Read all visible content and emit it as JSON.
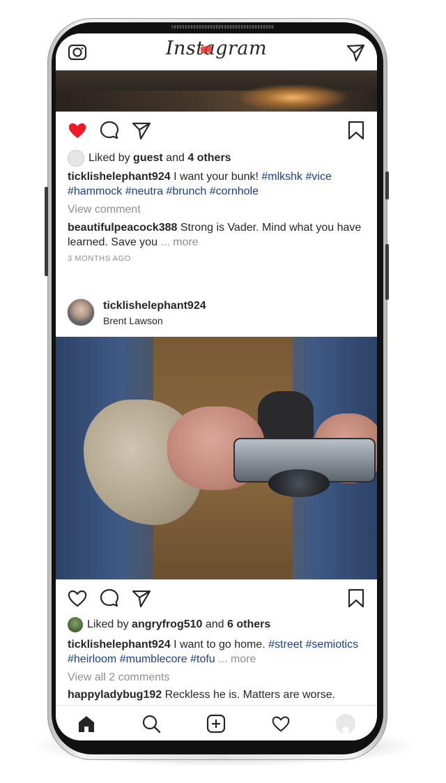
{
  "app": {
    "title": "Instagram"
  },
  "post1": {
    "liked": true,
    "liked_by_prefix": "Liked by",
    "liked_by_user": "guest",
    "liked_by_and": "and",
    "liked_by_others": "4 others",
    "caption_user": "ticklishelephant924",
    "caption_text": " I want your bunk! ",
    "tags": [
      "#mlkshk",
      "#vice",
      "#hammock",
      "#neutra",
      "#brunch",
      "#cornhole"
    ],
    "view_comments": "View comment",
    "comment_user": "beautifulpeacock388",
    "comment_text": " Strong is Vader. Mind what you have learned. Save you",
    "more": "... more",
    "time": "3 MONTHS AGO"
  },
  "post2": {
    "username": "ticklishelephant924",
    "location": "Brent Lawson",
    "liked": false,
    "liked_by_prefix": "Liked by",
    "liked_by_user": "angryfrog510",
    "liked_by_and": "and",
    "liked_by_others": "6 others",
    "caption_user": "ticklishelephant924",
    "caption_text": " I want to go home. ",
    "tags": [
      "#street",
      "#semiotics",
      "#heirloom",
      "#mumblecore",
      "#tofu"
    ],
    "more": "... more",
    "view_comments": "View all 2 comments",
    "comment_user": "happyladybug192",
    "comment_text": " Reckless he is. Matters are worse."
  },
  "icons": {
    "camera": "camera-icon",
    "direct": "paper-plane-icon",
    "heart": "heart-icon",
    "comment": "comment-icon",
    "share": "paper-plane-icon",
    "bookmark": "bookmark-icon",
    "home": "home-icon",
    "search": "search-icon",
    "add": "add-post-icon",
    "activity": "heart-icon",
    "profile": "profile-avatar"
  },
  "colors": {
    "like": "#ed1c24",
    "hashtag": "#1b3f8f",
    "muted": "#8e8e8e"
  }
}
